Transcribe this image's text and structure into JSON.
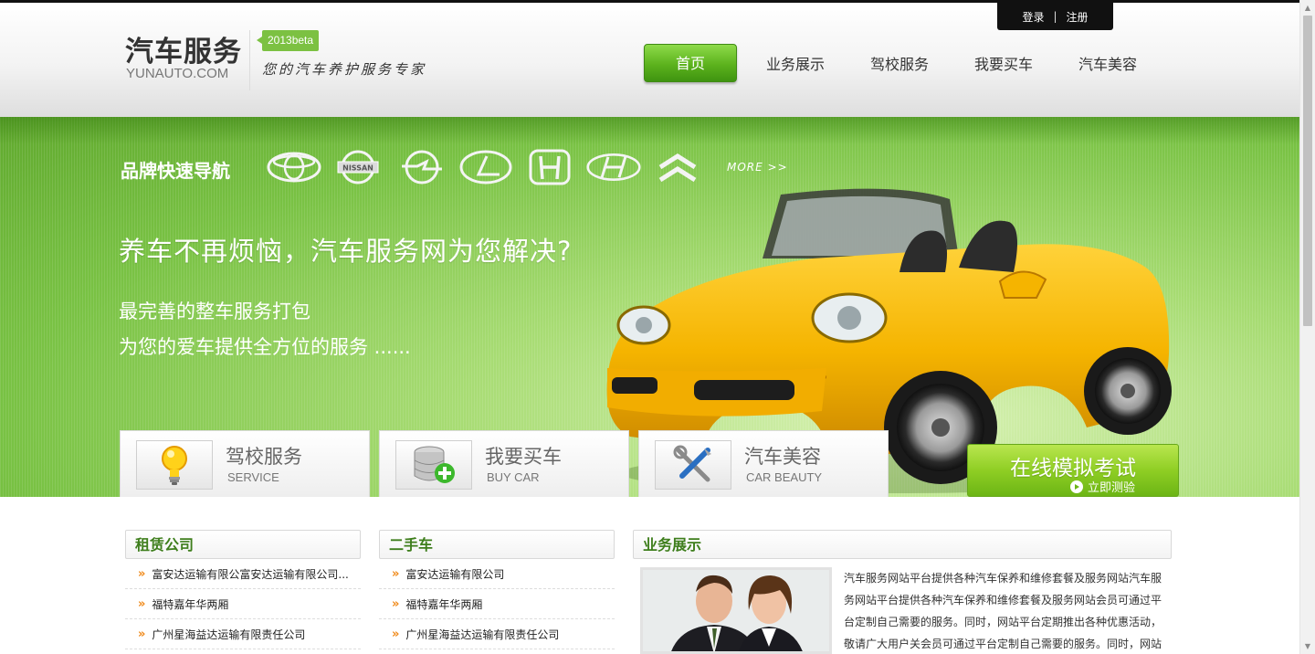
{
  "header": {
    "site_title": "汽车服务",
    "domain": "YUNAUTO.COM",
    "beta_badge": "2013beta",
    "slogan": "您的汽车养护服务专家",
    "login": "登录",
    "separator": "|",
    "register": "注册",
    "nav": [
      "首页",
      "业务展示",
      "驾校服务",
      "我要买车",
      "汽车美容"
    ]
  },
  "banner": {
    "brand_nav_title": "品牌快速导航",
    "brand_logos": [
      "toyota-logo",
      "nissan-logo",
      "opel-logo",
      "lexus-logo",
      "honda-logo",
      "hyundai-logo",
      "citroen-logo"
    ],
    "nissan_text": "NISSAN",
    "more": "MORE >>",
    "headline": "养车不再烦恼，汽车服务网为您解决?",
    "sub1": "最完善的整车服务打包",
    "sub2": "为您的爱车提供全方位的服务 ......",
    "services": [
      {
        "cn": "驾校服务",
        "en": "SERVICE",
        "icon": "lightbulb-icon"
      },
      {
        "cn": "我要买车",
        "en": "BUY CAR",
        "icon": "database-add-icon"
      },
      {
        "cn": "汽车美容",
        "en": "CAR BEAUTY",
        "icon": "tools-icon"
      }
    ],
    "exam_title": "在线模拟考试",
    "exam_sub": "立即测验"
  },
  "rental": {
    "title": "租赁公司",
    "items": [
      "富安达运输有限公富安达运输有限公司...",
      "福特嘉年华两厢",
      "广州星海益达运输有限责任公司"
    ]
  },
  "used_cars": {
    "title": "二手车",
    "items": [
      "富安达运输有限公司",
      "福特嘉年华两厢",
      "广州星海益达运输有限责任公司"
    ]
  },
  "business": {
    "title": "业务展示",
    "text": "汽车服务网站平台提供各种汽车保养和维修套餐及服务网站汽车服务网站平台提供各种汽车保养和维修套餐及服务网站会员可通过平台定制自己需要的服务。同时，网站平台定期推出各种优惠活动，敬请广大用户关会员可通过平台定制自己需要的服务。同时，网站"
  },
  "colors": {
    "accent_green": "#5cb21d",
    "heading_green": "#3e7e1c",
    "arrow_orange": "#f08a1a",
    "car_yellow": "#f5b400"
  }
}
